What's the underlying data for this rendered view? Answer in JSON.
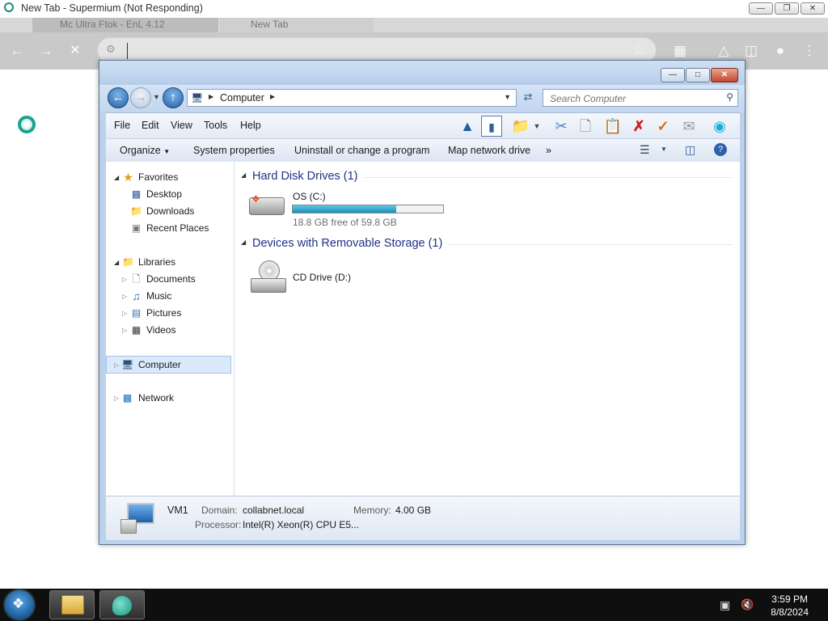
{
  "browser": {
    "title": "New Tab - Supermium (Not Responding)",
    "tabs": [
      {
        "label": "Mc Ultra Ftok - EnL 4.12"
      },
      {
        "label": "New Tab"
      }
    ],
    "omnibox_value": ""
  },
  "explorer": {
    "address": {
      "crumbs": [
        "Computer"
      ],
      "search_placeholder": "Search Computer"
    },
    "menu": [
      "File",
      "Edit",
      "View",
      "Tools",
      "Help"
    ],
    "commands": [
      "Organize",
      "System properties",
      "Uninstall or change a program",
      "Map network drive",
      "»"
    ],
    "nav": {
      "favorites": {
        "label": "Favorites",
        "items": [
          "Desktop",
          "Downloads",
          "Recent Places"
        ]
      },
      "libraries": {
        "label": "Libraries",
        "items": [
          "Documents",
          "Music",
          "Pictures",
          "Videos"
        ]
      },
      "computer": "Computer",
      "network": "Network"
    },
    "groups": {
      "hdd": {
        "title": "Hard Disk Drives (1)",
        "drive_name": "OS (C:)",
        "free_text": "18.8 GB free of 59.8 GB",
        "used_fraction": 0.686
      },
      "removable": {
        "title": "Devices with Removable Storage (1)",
        "drive_name": "CD Drive (D:)"
      }
    },
    "details": {
      "name": "VM1",
      "domain_label": "Domain:",
      "domain_value": "collabnet.local",
      "memory_label": "Memory:",
      "memory_value": "4.00 GB",
      "processor_label": "Processor:",
      "processor_value": "Intel(R) Xeon(R) CPU E5..."
    }
  },
  "taskbar": {
    "time": "3:59 PM",
    "date": "8/8/2024"
  },
  "colors": {
    "explorer_frame": "#bcd2ec",
    "group_title": "#1e3287",
    "progress_fill": "#1f9bc7",
    "taskbar": "#0f0f0f"
  }
}
